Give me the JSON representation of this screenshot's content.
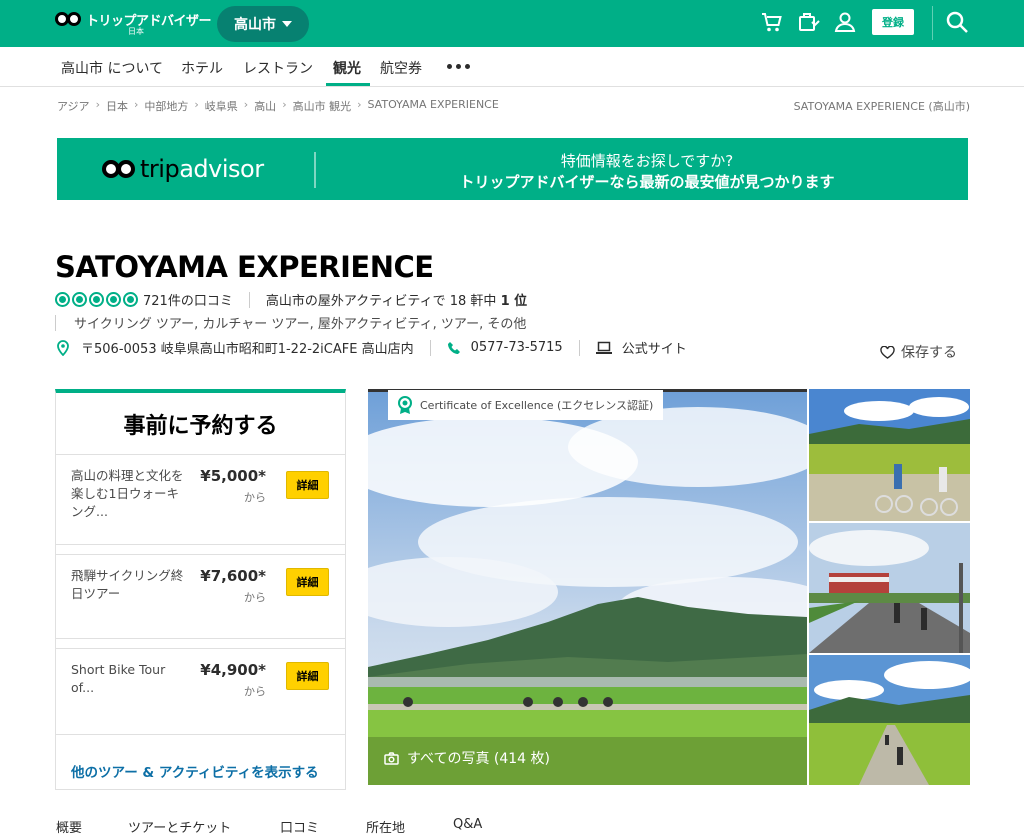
{
  "header": {
    "logo_text": "トリップアドバイザー",
    "logo_sub": "日本",
    "city": "高山市",
    "register": "登録"
  },
  "nav": {
    "items": [
      "高山市 について",
      "ホテル",
      "レストラン",
      "観光",
      "航空券"
    ]
  },
  "breadcrumb": {
    "items": [
      "アジア",
      "日本",
      "中部地方",
      "岐阜県",
      "高山",
      "高山市 観光",
      "SATOYAMA EXPERIENCE"
    ],
    "right": "SATOYAMA EXPERIENCE (高山市)"
  },
  "banner": {
    "logo_word": "trip",
    "logo_word2": "advisor",
    "line1": "特価情報をお探しですか?",
    "line2": "トリップアドバイザーなら最新の最安値が見つかります"
  },
  "listing": {
    "title": "SATOYAMA EXPERIENCE",
    "rating": 5,
    "reviews": "721件の口コミ",
    "rank_prefix": "高山市の屋外アクティビティで 18 軒中",
    "rank_value": "1 位",
    "categories": "サイクリング ツアー, カルチャー ツアー, 屋外アクティビティ, ツアー, その他",
    "address": "〒506-0053 岐阜県高山市昭和町1-22-2iCAFE 高山店内",
    "phone": "0577-73-5715",
    "website": "公式サイト",
    "save": "保存する"
  },
  "booking": {
    "title": "事前に予約する",
    "tours": [
      {
        "name": "高山の料理と文化を楽しむ1日ウォーキング...",
        "price": "¥5,000*",
        "from": "から",
        "button": "詳細"
      },
      {
        "name": "飛騨サイクリング終日ツアー",
        "price": "¥7,600*",
        "from": "から",
        "button": "詳細"
      },
      {
        "name": "Short Bike Tour of...",
        "price": "¥4,900*",
        "from": "から",
        "button": "詳細"
      }
    ],
    "more": "他のツアー & アクティビティを表示する"
  },
  "photos": {
    "certificate": "Certificate of Excellence (エクセレンス認証)",
    "all": "すべての写真 (414 枚)"
  },
  "tabs": [
    "概要",
    "ツアーとチケット",
    "口コミ",
    "所在地",
    "Q&A"
  ],
  "colors": {
    "brand": "#00af87",
    "button": "#ffd000",
    "link": "#0d6fa6"
  }
}
